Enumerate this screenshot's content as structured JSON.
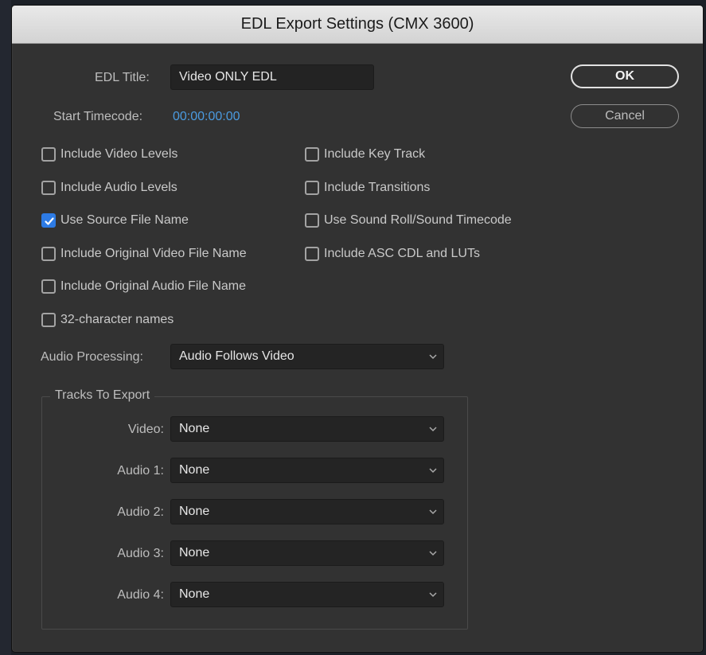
{
  "window": {
    "title": "EDL Export Settings (CMX 3600)"
  },
  "edl_title": {
    "label": "EDL Title:",
    "value": "Video ONLY EDL"
  },
  "start_timecode": {
    "label": "Start Timecode:",
    "value": "00:00:00:00"
  },
  "buttons": {
    "ok": "OK",
    "cancel": "Cancel"
  },
  "options_left": [
    {
      "label": "Include Video Levels",
      "checked": false
    },
    {
      "label": "Include Audio Levels",
      "checked": false
    },
    {
      "label": "Use Source File Name",
      "checked": true
    },
    {
      "label": "Include Original Video File Name",
      "checked": false
    },
    {
      "label": "Include Original Audio File Name",
      "checked": false
    },
    {
      "label": "32-character names",
      "checked": false
    }
  ],
  "options_right": [
    {
      "label": "Include Key Track",
      "checked": false
    },
    {
      "label": "Include Transitions",
      "checked": false
    },
    {
      "label": "Use Sound Roll/Sound Timecode",
      "checked": false
    },
    {
      "label": "Include ASC CDL and LUTs",
      "checked": false
    }
  ],
  "audio_processing": {
    "label": "Audio Processing:",
    "value": "Audio Follows Video"
  },
  "tracks": {
    "legend": "Tracks To Export",
    "video": {
      "label": "Video:",
      "value": "None"
    },
    "audio1": {
      "label": "Audio 1:",
      "value": "None"
    },
    "audio2": {
      "label": "Audio 2:",
      "value": "None"
    },
    "audio3": {
      "label": "Audio 3:",
      "value": "None"
    },
    "audio4": {
      "label": "Audio 4:",
      "value": "None"
    }
  },
  "colors": {
    "accent": "#2d7be5",
    "timecode": "#4b9be0",
    "panel": "#323232"
  }
}
